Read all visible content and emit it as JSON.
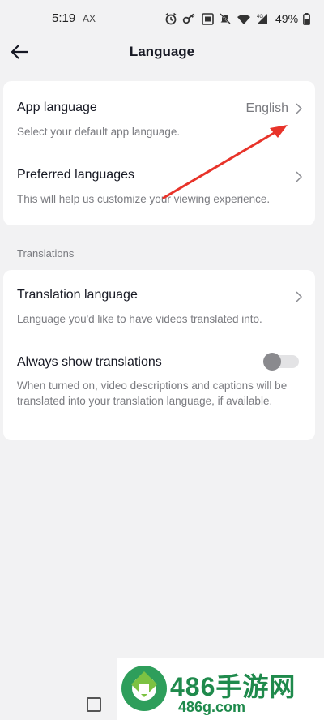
{
  "status_bar": {
    "time": "5:19",
    "carrier": "AX",
    "network": "4G",
    "battery": "49%"
  },
  "header": {
    "title": "Language"
  },
  "sections": {
    "general": {
      "app_language": {
        "title": "App language",
        "value": "English",
        "subtitle": "Select your default app language."
      },
      "preferred_languages": {
        "title": "Preferred languages",
        "subtitle": "This will help us customize your viewing experience."
      }
    },
    "translations": {
      "label": "Translations",
      "translation_language": {
        "title": "Translation language",
        "subtitle": "Language you'd like to have videos translated into."
      },
      "always_show": {
        "title": "Always show translations",
        "subtitle": "When turned on, video descriptions and captions will be translated into your translation language, if available.",
        "enabled": false
      }
    }
  },
  "watermark": {
    "text": "486手游网",
    "domain": "486g.com"
  },
  "colors": {
    "background": "#f2f2f3",
    "card": "#ffffff",
    "annotation_arrow": "#e8332a",
    "watermark_green": "#1f8a4c"
  },
  "icons": [
    "back-arrow-icon",
    "chevron-right-icon",
    "alarm-icon",
    "key-icon",
    "nfc-icon",
    "mute-icon",
    "wifi-icon",
    "battery-icon"
  ]
}
